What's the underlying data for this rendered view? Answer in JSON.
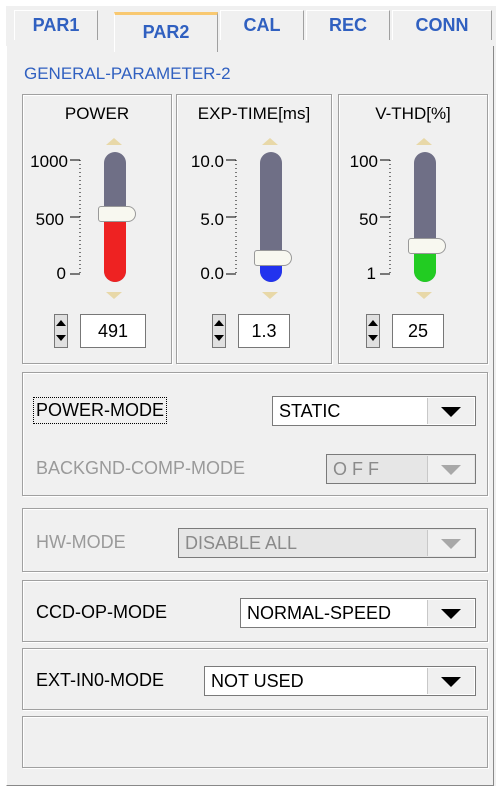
{
  "tabs": [
    {
      "label": "PAR1",
      "active": false
    },
    {
      "label": "PAR2",
      "active": true
    },
    {
      "label": "CAL",
      "active": false
    },
    {
      "label": "REC",
      "active": false
    },
    {
      "label": "CONN",
      "active": false
    }
  ],
  "section_title": "GENERAL-PARAMETER-2",
  "sliders": [
    {
      "label": "POWER",
      "ticks": [
        "1000",
        "500",
        "0"
      ],
      "value": "491",
      "fill_color": "#ee2222",
      "level": 0.49
    },
    {
      "label": "EXP-TIME[ms]",
      "ticks": [
        "10.0",
        "5.0",
        "0.0"
      ],
      "value": "1.3",
      "fill_color": "#2233ee",
      "level": 0.13
    },
    {
      "label": "V-THD[%]",
      "ticks": [
        "100",
        "50",
        "1"
      ],
      "value": "25",
      "fill_color": "#22cc22",
      "level": 0.25
    }
  ],
  "power_mode": {
    "label": "POWER-MODE",
    "value": "STATIC"
  },
  "backgnd_comp_mode": {
    "label": "BACKGND-COMP-MODE",
    "value": "O F F"
  },
  "hw_mode": {
    "label": "HW-MODE",
    "value": "DISABLE ALL"
  },
  "ccd_op_mode": {
    "label": "CCD-OP-MODE",
    "value": "NORMAL-SPEED"
  },
  "ext_in0_mode": {
    "label": "EXT-IN0-MODE",
    "value": "NOT USED"
  }
}
